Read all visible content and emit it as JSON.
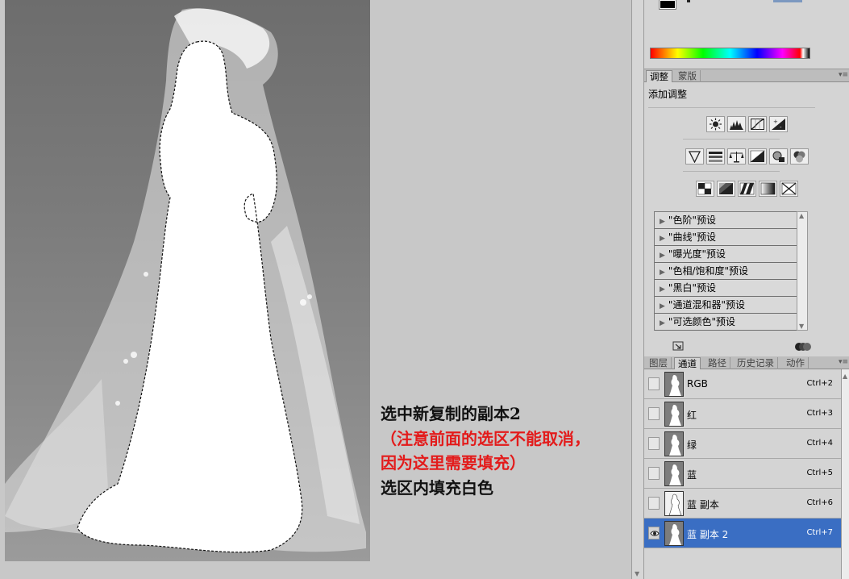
{
  "caption": {
    "line1": "选中新复制的副本2",
    "line2": "（注意前面的选区不能取消，",
    "line3": "因为这里需要填充）",
    "line4": "选区内填充白色"
  },
  "adjustments": {
    "tabs": [
      "调整",
      "蒙版"
    ],
    "title": "添加调整",
    "icon_rows": [
      [
        "brightness-contrast-icon",
        "levels-icon",
        "curves-icon",
        "exposure-icon"
      ],
      [
        "vibrance-icon",
        "hue-saturation-icon",
        "color-balance-icon",
        "black-white-icon",
        "photo-filter-icon",
        "channel-mixer-icon"
      ],
      [
        "invert-icon",
        "posterize-icon",
        "threshold-icon",
        "gradient-map-icon",
        "selective-color-icon"
      ]
    ],
    "presets": [
      "\"色阶\"预设",
      "\"曲线\"预设",
      "\"曝光度\"预设",
      "\"色相/饱和度\"预设",
      "\"黑白\"预设",
      "\"通道混和器\"预设",
      "\"可选颜色\"预设"
    ]
  },
  "channels": {
    "tabs": [
      "图层",
      "通道",
      "路径",
      "历史记录",
      "动作"
    ],
    "active_tab": 1,
    "rows": [
      {
        "name": "RGB",
        "key": "Ctrl+2",
        "visible": false,
        "selected": false,
        "thumb": "gray"
      },
      {
        "name": "红",
        "key": "Ctrl+3",
        "visible": false,
        "selected": false,
        "thumb": "gray"
      },
      {
        "name": "绿",
        "key": "Ctrl+4",
        "visible": false,
        "selected": false,
        "thumb": "gray"
      },
      {
        "name": "蓝",
        "key": "Ctrl+5",
        "visible": false,
        "selected": false,
        "thumb": "gray"
      },
      {
        "name": "蓝 副本",
        "key": "Ctrl+6",
        "visible": false,
        "selected": false,
        "thumb": "white"
      },
      {
        "name": "蓝 副本 2",
        "key": "Ctrl+7",
        "visible": true,
        "selected": true,
        "thumb": "gray"
      }
    ]
  },
  "colors": {
    "selection_fill": "#ffffff",
    "selected_row": "#3a6ec3",
    "caption_red": "#e31b1b"
  }
}
